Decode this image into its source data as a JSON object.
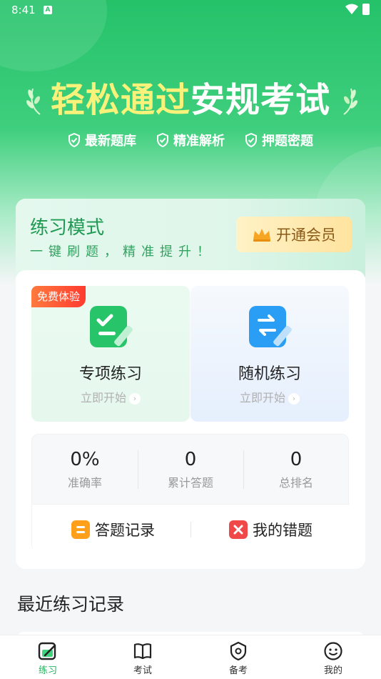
{
  "status_bar": {
    "time": "8:41",
    "notif_icon": "a-icon"
  },
  "hero": {
    "headline_part1": "轻松通过",
    "headline_part2": "安规考试",
    "features": [
      "最新题库",
      "精准解析",
      "押题密题"
    ]
  },
  "mode_card": {
    "title": "练习模式",
    "subtitle": "一键刷题，精准提升！",
    "vip_label": "开通会员",
    "free_tag": "免费体验",
    "practices": [
      {
        "title": "专项练习",
        "start": "立即开始",
        "color": "#27c46a"
      },
      {
        "title": "随机练习",
        "start": "立即开始",
        "color": "#2a9df4"
      }
    ]
  },
  "stats": [
    {
      "value": "0%",
      "label": "准确率"
    },
    {
      "value": "0",
      "label": "累计答题"
    },
    {
      "value": "0",
      "label": "总排名"
    }
  ],
  "actions": [
    {
      "label": "答题记录",
      "color": "#ff9f1a"
    },
    {
      "label": "我的错题",
      "color": "#f04848"
    }
  ],
  "recent": {
    "title": "最近练习记录"
  },
  "tabs": [
    {
      "label": "练习",
      "active": true
    },
    {
      "label": "考试",
      "active": false
    },
    {
      "label": "备考",
      "active": false
    },
    {
      "label": "我的",
      "active": false
    }
  ],
  "colors": {
    "brand": "#20b75d",
    "headline_accent": "#f9f27a"
  }
}
